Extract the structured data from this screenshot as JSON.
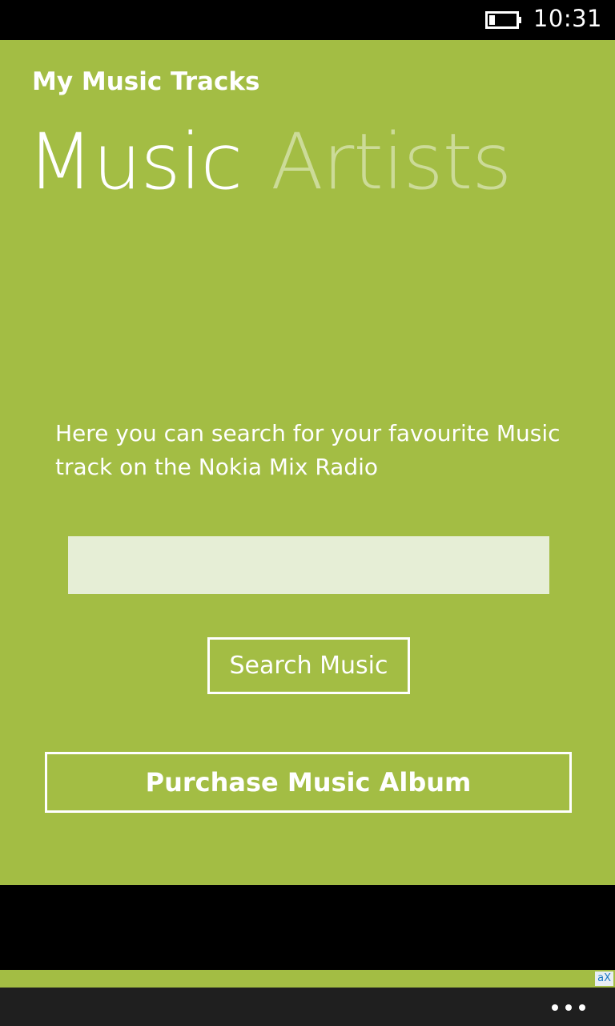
{
  "status_bar": {
    "time": "10:31",
    "battery_icon": "battery-low-icon"
  },
  "app": {
    "title": "My Music Tracks",
    "pivot": {
      "active_tab": "Music",
      "inactive_tab": "Artists"
    },
    "description": "Here you can search for your favourite Music track on the Nokia Mix Radio",
    "search": {
      "value": "",
      "placeholder": ""
    },
    "search_button_label": "Search Music",
    "purchase_button_label": "Purchase Music Album"
  },
  "ad": {
    "badge": "aX"
  },
  "app_bar": {
    "more_icon": "ellipsis-icon"
  },
  "colors": {
    "accent": "#a3bd44",
    "input_background": "#e6eed6",
    "app_bar": "#1f1f1f"
  }
}
